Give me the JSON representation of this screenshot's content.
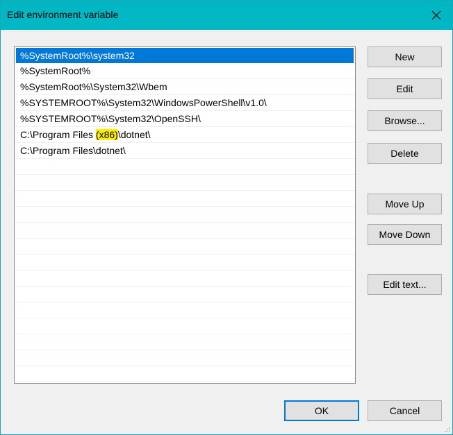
{
  "window": {
    "title": "Edit environment variable"
  },
  "list": {
    "items": [
      {
        "before": "%SystemRoot%\\system32",
        "highlight": "",
        "after": "",
        "selected": true
      },
      {
        "before": "%SystemRoot%",
        "highlight": "",
        "after": "",
        "selected": false
      },
      {
        "before": "%SystemRoot%\\System32\\Wbem",
        "highlight": "",
        "after": "",
        "selected": false
      },
      {
        "before": "%SYSTEMROOT%\\System32\\WindowsPowerShell\\v1.0\\",
        "highlight": "",
        "after": "",
        "selected": false
      },
      {
        "before": "%SYSTEMROOT%\\System32\\OpenSSH\\",
        "highlight": "",
        "after": "",
        "selected": false
      },
      {
        "before": "C:\\Program Files ",
        "highlight": "(x86)",
        "after": "\\dotnet\\",
        "selected": false
      },
      {
        "before": "C:\\Program Files\\dotnet\\",
        "highlight": "",
        "after": "",
        "selected": false
      }
    ]
  },
  "buttons": {
    "new": "New",
    "edit": "Edit",
    "browse": "Browse...",
    "delete": "Delete",
    "move_up": "Move Up",
    "move_down": "Move Down",
    "edit_text": "Edit text...",
    "ok": "OK",
    "cancel": "Cancel"
  },
  "colors": {
    "titlebar": "#00b7c3",
    "selection": "#0078d7",
    "highlight": "#ffee00"
  }
}
